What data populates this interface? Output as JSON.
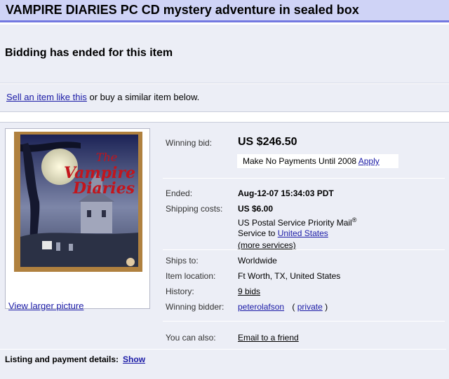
{
  "page": {
    "title": "VAMPIRE DIARIES PC CD mystery adventure in sealed box",
    "status_message": "Bidding has ended for this item"
  },
  "sell_bar": {
    "link": "Sell an item like this",
    "text": " or buy a similar item below."
  },
  "item": {
    "picture_link": "View larger picture",
    "picture_logo_text": "The Vampire Diaries",
    "winning_bid_label": "Winning bid:",
    "winning_bid_value": "US $246.50",
    "promo_text": "Make No Payments Until 2008 ",
    "promo_link": "Apply",
    "ended_label": "Ended:",
    "ended_value": "Aug-12-07 15:34:03 PDT",
    "shipping_label": "Shipping costs:",
    "shipping_value": "US $6.00",
    "shipping_service": "US Postal Service Priority Mail",
    "shipping_service_mark": "®",
    "service_to_text": "Service to ",
    "service_to_link": "United States",
    "more_services_link": "(more services)",
    "ships_to_label": "Ships to:",
    "ships_to_value": "Worldwide",
    "location_label": "Item location:",
    "location_value": "Ft Worth, TX, United States",
    "history_label": "History:",
    "history_link": "9 bids",
    "winner_label": "Winning bidder:",
    "winner_link": "peterolafson",
    "private_open": "( ",
    "private_link": "private",
    "private_close": " )",
    "also_label": "You can also:",
    "also_link": "Email to a friend"
  },
  "listing": {
    "label": "Listing and payment details:",
    "show_link": "Show"
  },
  "colors": {
    "title_bar": "#cfd3f6",
    "title_border": "#7378e0",
    "panel": "#eceef6",
    "link": "#1a1aa6"
  }
}
